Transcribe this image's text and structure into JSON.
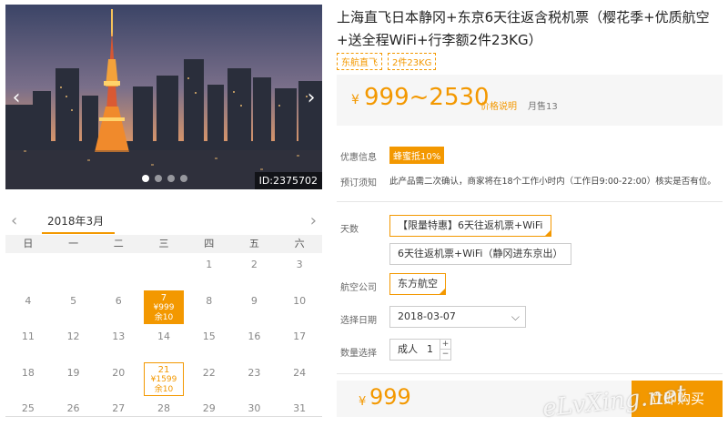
{
  "gallery": {
    "image_id": "ID:2375702",
    "dots": 4,
    "active_dot": 0
  },
  "calendar": {
    "month": "2018年3月",
    "weekdays": [
      "日",
      "一",
      "二",
      "三",
      "四",
      "五",
      "六"
    ],
    "rows": [
      [
        null,
        null,
        null,
        null,
        {
          "day": "1"
        },
        {
          "day": "2"
        },
        {
          "day": "3"
        }
      ],
      [
        {
          "day": "4"
        },
        {
          "day": "5"
        },
        {
          "day": "6"
        },
        {
          "day": "7",
          "price": "¥999",
          "stock": "余10",
          "selected": true
        },
        {
          "day": "8"
        },
        {
          "day": "9"
        },
        {
          "day": "10"
        }
      ],
      [
        {
          "day": "11"
        },
        {
          "day": "12"
        },
        {
          "day": "13"
        },
        {
          "day": "14"
        },
        {
          "day": "15"
        },
        {
          "day": "16"
        },
        {
          "day": "17"
        }
      ],
      [
        {
          "day": "18"
        },
        {
          "day": "19"
        },
        {
          "day": "20"
        },
        {
          "day": "21",
          "price": "¥1599",
          "stock": "余10"
        },
        {
          "day": "22"
        },
        {
          "day": "23"
        },
        {
          "day": "24"
        }
      ],
      [
        {
          "day": "25"
        },
        {
          "day": "26"
        },
        {
          "day": "27"
        },
        {
          "day": "28"
        },
        {
          "day": "29"
        },
        {
          "day": "30"
        },
        {
          "day": "31"
        }
      ]
    ]
  },
  "product": {
    "title": "上海直飞日本静冈+东京6天往返含税机票（樱花季+优质航空+送全程WiFi+行李额2件23KG）",
    "tags": [
      "东航直飞",
      "2件23KG"
    ],
    "price_yen": "¥",
    "price_range": "999~2530",
    "price_note": "价格说明",
    "monthly_sales": "月售13"
  },
  "promo": {
    "label": "优惠信息",
    "badge": "蜂蜜抵10%"
  },
  "booking_notice": {
    "label": "预订须知",
    "text": "此产品需二次确认，商家将在18个工作小时内（工作日9:00-22:00）核实是否有位。"
  },
  "options": {
    "days_label": "天数",
    "days": [
      {
        "label": "【限量特惠】6天往返机票+WiFi",
        "selected": true
      },
      {
        "label": "6天往返机票+WiFi（静冈进东京出）",
        "selected": false
      }
    ],
    "airline_label": "航空公司",
    "airline": "东方航空",
    "date_label": "选择日期",
    "date_value": "2018-03-07",
    "qty_label": "数量选择",
    "qty_type": "成人",
    "qty_value": "1"
  },
  "checkout": {
    "yen": "¥",
    "total": "999",
    "buy_label": "立即购买"
  },
  "watermark": "eLvXing.net",
  "colors": {
    "accent": "#f39800",
    "panel_bg": "#f6f6f6"
  }
}
